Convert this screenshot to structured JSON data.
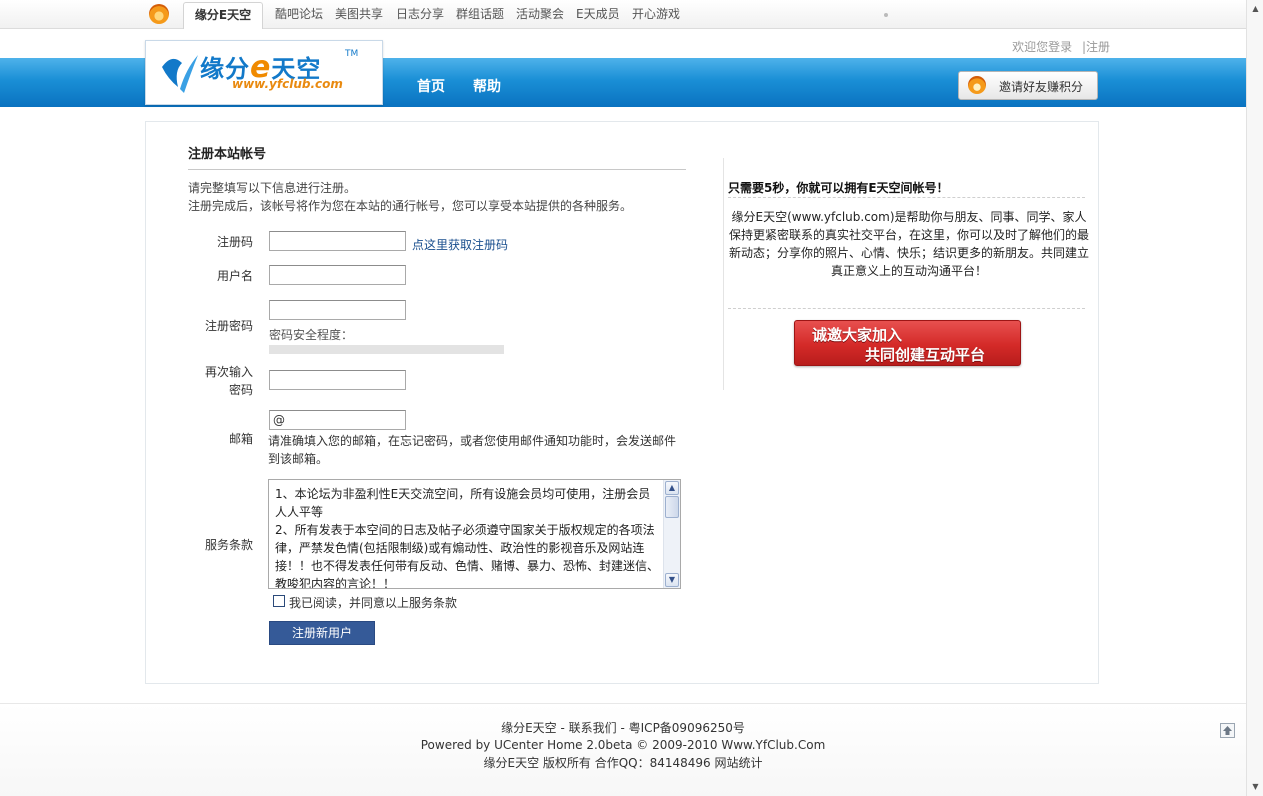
{
  "top_nav": {
    "active": "缘分E天空",
    "items": [
      "酷吧论坛",
      "美图共享",
      "日志分享",
      "群组话题",
      "活动聚会",
      "E天成员",
      "开心游戏"
    ]
  },
  "header": {
    "welcome": "欢迎您登录",
    "register": "|注册",
    "logo_text_a": "缘分",
    "logo_text_e": "e",
    "logo_text_b": "天空",
    "logo_tm": "TM",
    "logo_url": "www.yfclub.com",
    "nav": [
      "首页",
      "帮助"
    ],
    "invite_label": "邀请好友赚积分"
  },
  "form": {
    "title": "注册本站帐号",
    "intro1": "请完整填写以下信息进行注册。",
    "intro2": "注册完成后，该帐号将作为您在本站的通行帐号，您可以享受本站提供的各种服务。",
    "code_label": "注册码",
    "code_link": "点这里获取注册码",
    "username_label": "用户名",
    "password_label": "注册密码",
    "strength_label": "密码安全程度：",
    "repeat_label_1": "再次输入",
    "repeat_label_2": "密码",
    "email_label": "邮箱",
    "email_value": "@",
    "email_hint": "请准确填入您的邮箱，在忘记密码，或者您使用邮件通知功能时，会发送邮件到该邮箱。",
    "terms_label": "服务条款",
    "terms_text": [
      "1、本论坛为非盈利性E天交流空间，所有设施会员均可使用，注册会员人人平等",
      "2、所有发表于本空间的日志及帖子必须遵守国家关于版权规定的各项法律，严禁发色情(包括限制级)或有煽动性、政治性的影视音乐及网站连接！！也不得发表任何带有反动、色情、赌博、暴力、恐怖、封建迷信、教唆犯内容的言论！！"
    ],
    "agree_label": "我已阅读，并同意以上服务条款",
    "submit_label": "注册新用户"
  },
  "sidebar": {
    "title": "只需要5秒，你就可以拥有E天空间帐号！",
    "text": "缘分E天空(www.yfclub.com)是帮助你与朋友、同事、同学、家人保持更紧密联系的真实社交平台，在这里，你可以及时了解他们的最新动态；分享你的照片、心情、快乐；结识更多的新朋友。共同建立真正意义上的互动沟通平台！",
    "banner_line1": "诚邀大家加入",
    "banner_line2": "共同创建互动平台"
  },
  "footer": {
    "line1_a": "缘分E天空",
    "line1_b": "- 联系我们",
    "line1_c": "- 粤ICP备09096250号",
    "line2": "Powered by UCenter Home 2.0beta © 2009-2010 Www.YfClub.Com",
    "line3_a": "缘分E天空 版权所有 合作QQ：84148496",
    "line3_b": "网站统计"
  }
}
